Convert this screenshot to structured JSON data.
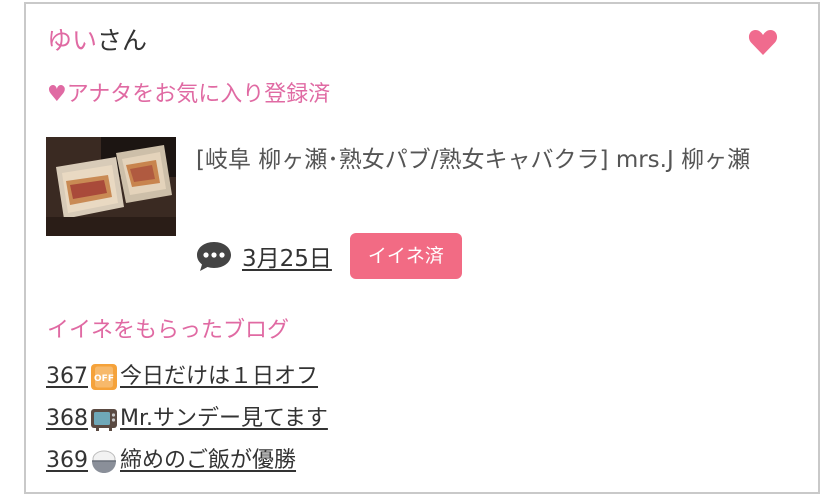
{
  "user": {
    "name": "ゆい",
    "suffix": "さん"
  },
  "favorite_status": "♥アナタをお気に入り登録済",
  "shop": {
    "title": "[岐阜 柳ヶ瀬･熟女パブ/熟女キャバクラ]  mrs.J 柳ヶ瀬"
  },
  "post": {
    "date": "3月25日",
    "like_badge": "イイネ済"
  },
  "liked_blogs": {
    "heading": "イイネをもらったブログ",
    "items": [
      {
        "number": "367",
        "emoji": "off-sign-icon",
        "title": "今日だけは１日オフ"
      },
      {
        "number": "368",
        "emoji": "television-icon",
        "title": "Mr.サンデー見てます"
      },
      {
        "number": "369",
        "emoji": "rice-bowl-icon",
        "title": "締めのご飯が優勝"
      }
    ]
  },
  "colors": {
    "accent_pink": "#e06aa3",
    "badge": "#f26b84",
    "heart": "#f06b8e",
    "text": "#333333"
  }
}
